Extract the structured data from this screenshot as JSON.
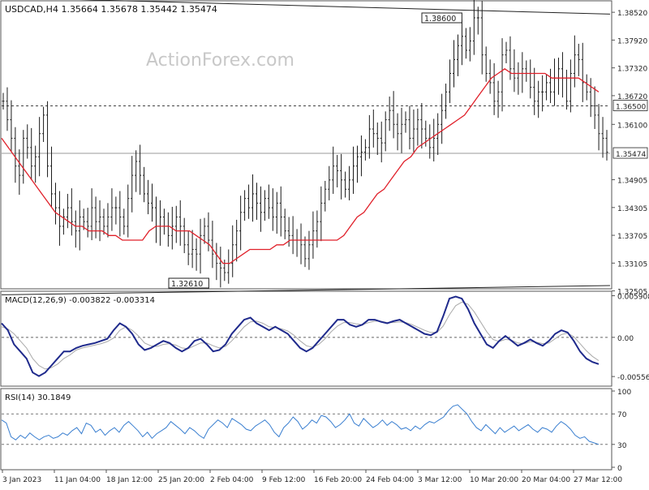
{
  "header": {
    "symbol_line": "USDCAD,H4  1.35664 1.35678 1.35442 1.35474"
  },
  "watermark": "ActionForex.com",
  "colors": {
    "candle": "#1a1a1a",
    "ma": "#e0202a",
    "macd_line": "#1f2a8c",
    "macd_signal": "#aaaaaa",
    "rsi": "#3a7fd0",
    "grid_dash": "#444444",
    "axis_text": "#222222"
  },
  "chart_data": [
    {
      "type": "line",
      "name": "price",
      "title": "USDCAD,H4  1.35664 1.35678 1.35442 1.35474",
      "ylim": [
        1.3255,
        1.3875
      ],
      "yticks": [
        "1.38520",
        "1.37920",
        "1.37320",
        "1.36720",
        "1.36100",
        "1.35474",
        "1.34905",
        "1.34305",
        "1.33705",
        "1.33105",
        "1.32505"
      ],
      "ytick_values": [
        1.3852,
        1.3792,
        1.3732,
        1.3672,
        1.361,
        1.35474,
        1.34905,
        1.34305,
        1.33705,
        1.33105,
        1.32505
      ],
      "xlabels": [
        "3 Jan 2023",
        "11 Jan 04:00",
        "18 Jan 12:00",
        "25 Jan 20:00",
        "2 Feb 04:00",
        "9 Feb 12:00",
        "16 Feb 20:00",
        "24 Feb 04:00",
        "3 Mar 12:00",
        "10 Mar 20:00",
        "20 Mar 04:00",
        "27 Mar 12:00"
      ],
      "annotations": {
        "high_label": "1.38600",
        "low_label": "1.32610",
        "level_label": "1.36500",
        "last_price": "1.35474",
        "high_value": 1.386,
        "low_value": 1.3261,
        "level_value": 1.365
      },
      "series": [
        {
          "values": [
            1.366,
            1.362,
            1.358,
            1.352,
            1.35,
            1.358,
            1.356,
            1.352,
            1.354,
            1.359,
            1.363,
            1.352,
            1.346,
            1.343,
            1.339,
            1.341,
            1.343,
            1.34,
            1.338,
            1.341,
            1.34,
            1.339,
            1.343,
            1.34,
            1.341,
            1.339,
            1.341,
            1.343,
            1.343,
            1.341,
            1.339,
            1.345,
            1.35,
            1.353,
            1.35,
            1.346,
            1.344,
            1.343,
            1.339,
            1.341,
            1.339,
            1.337,
            1.339,
            1.341,
            1.339,
            1.335,
            1.333,
            1.334,
            1.333,
            1.337,
            1.339,
            1.336,
            1.333,
            1.331,
            1.33,
            1.329,
            1.331,
            1.335,
            1.338,
            1.342,
            1.345,
            1.343,
            1.346,
            1.344,
            1.342,
            1.345,
            1.343,
            1.341,
            1.344,
            1.341,
            1.338,
            1.337,
            1.336,
            1.336,
            1.335,
            1.332,
            1.335,
            1.338,
            1.34,
            1.344,
            1.347,
            1.349,
            1.352,
            1.351,
            1.349,
            1.347,
            1.349,
            1.352,
            1.354,
            1.355,
            1.356,
            1.36,
            1.359,
            1.358,
            1.357,
            1.362,
            1.364,
            1.361,
            1.359,
            1.361,
            1.362,
            1.358,
            1.36,
            1.362,
            1.36,
            1.358,
            1.356,
            1.358,
            1.361,
            1.364,
            1.368,
            1.372,
            1.375,
            1.378,
            1.38,
            1.377,
            1.379,
            1.384,
            1.384,
            1.376,
            1.372,
            1.37,
            1.366,
            1.368,
            1.376,
            1.377,
            1.373,
            1.371,
            1.372,
            1.373,
            1.372,
            1.369,
            1.366,
            1.368,
            1.368,
            1.37,
            1.368,
            1.371,
            1.373,
            1.371,
            1.366,
            1.372,
            1.376,
            1.375,
            1.37,
            1.368,
            1.365,
            1.363,
            1.359,
            1.358,
            1.355
          ]
        },
        {
          "values": [
            1.358,
            1.356,
            1.354,
            1.352,
            1.35,
            1.348,
            1.346,
            1.344,
            1.342,
            1.341,
            1.34,
            1.339,
            1.339,
            1.338,
            1.338,
            1.338,
            1.337,
            1.337,
            1.336,
            1.336,
            1.336,
            1.336,
            1.338,
            1.339,
            1.339,
            1.339,
            1.338,
            1.338,
            1.338,
            1.337,
            1.336,
            1.335,
            1.333,
            1.331,
            1.331,
            1.332,
            1.333,
            1.334,
            1.334,
            1.334,
            1.334,
            1.335,
            1.335,
            1.336,
            1.336,
            1.336,
            1.336,
            1.336,
            1.336,
            1.336,
            1.336,
            1.337,
            1.339,
            1.341,
            1.342,
            1.344,
            1.346,
            1.347,
            1.349,
            1.351,
            1.353,
            1.354,
            1.356,
            1.357,
            1.358,
            1.359,
            1.36,
            1.361,
            1.362,
            1.363,
            1.365,
            1.367,
            1.369,
            1.371,
            1.372,
            1.373,
            1.372,
            1.372,
            1.372,
            1.372,
            1.372,
            1.372,
            1.371,
            1.371,
            1.371,
            1.371,
            1.371,
            1.37,
            1.369,
            1.368
          ]
        }
      ]
    },
    {
      "type": "line",
      "name": "macd",
      "title": "MACD(12,26,9) -0.003822 -0.003314",
      "ylim": [
        -0.0067,
        0.0062
      ],
      "yticks": [
        "0.005908",
        "0.00",
        "-0.005563"
      ],
      "ytick_values": [
        0.005908,
        0.0,
        -0.005563
      ],
      "series": [
        {
          "values": [
            0.002,
            0.001,
            -0.001,
            -0.002,
            -0.003,
            -0.005,
            -0.0055,
            -0.005,
            -0.004,
            -0.003,
            -0.002,
            -0.002,
            -0.0015,
            -0.0012,
            -0.001,
            -0.0008,
            -0.0005,
            -0.0002,
            0.001,
            0.002,
            0.0015,
            0.0005,
            -0.001,
            -0.0018,
            -0.0015,
            -0.001,
            -0.0005,
            -0.0008,
            -0.0015,
            -0.002,
            -0.0015,
            -0.0005,
            -0.0002,
            -0.001,
            -0.002,
            -0.0018,
            -0.001,
            0.0005,
            0.0015,
            0.0025,
            0.0028,
            0.002,
            0.0015,
            0.001,
            0.0015,
            0.001,
            0.0005,
            -0.0005,
            -0.0015,
            -0.002,
            -0.0015,
            -0.0005,
            0.0005,
            0.0015,
            0.0025,
            0.0025,
            0.0018,
            0.0015,
            0.0018,
            0.0025,
            0.0025,
            0.0022,
            0.002,
            0.0023,
            0.0025,
            0.002,
            0.0015,
            0.001,
            0.0005,
            0.0003,
            0.0008,
            0.003,
            0.0055,
            0.0058,
            0.0055,
            0.004,
            0.002,
            0.0005,
            -0.001,
            -0.0015,
            -0.0005,
            0.0002,
            -0.0005,
            -0.0012,
            -0.0008,
            -0.0003,
            -0.0008,
            -0.0012,
            -0.0005,
            0.0005,
            0.001,
            0.0007,
            -0.0005,
            -0.002,
            -0.003,
            -0.0035,
            -0.0038
          ]
        },
        {
          "values": [
            0.0015,
            0.0012,
            0.0005,
            -0.0005,
            -0.0015,
            -0.003,
            -0.004,
            -0.0045,
            -0.0043,
            -0.0038,
            -0.003,
            -0.0025,
            -0.0018,
            -0.0015,
            -0.0013,
            -0.0011,
            -0.0009,
            -0.0006,
            -0.0001,
            0.001,
            0.0015,
            0.001,
            0.0002,
            -0.0008,
            -0.0012,
            -0.0013,
            -0.001,
            -0.0009,
            -0.0011,
            -0.0015,
            -0.0016,
            -0.0012,
            -0.0008,
            -0.0008,
            -0.0012,
            -0.0015,
            -0.0013,
            -0.0005,
            0.0005,
            0.0015,
            0.0022,
            0.0023,
            0.002,
            0.0015,
            0.0014,
            0.0012,
            0.0009,
            0.0003,
            -0.0005,
            -0.0012,
            -0.0014,
            -0.001,
            -0.0002,
            0.0008,
            0.0016,
            0.0021,
            0.0021,
            0.0019,
            0.0018,
            0.0021,
            0.0023,
            0.0023,
            0.0021,
            0.0021,
            0.0022,
            0.0021,
            0.0018,
            0.0014,
            0.001,
            0.0007,
            0.0007,
            0.0016,
            0.0032,
            0.0045,
            0.005,
            0.0047,
            0.0036,
            0.0022,
            0.0008,
            -0.0003,
            -0.0006,
            -0.0003,
            -0.0004,
            -0.0008,
            -0.0009,
            -0.0006,
            -0.0007,
            -0.0009,
            -0.0008,
            -0.0002,
            0.0004,
            0.0006,
            0.0001,
            -0.0009,
            -0.0019,
            -0.0027,
            -0.0033
          ]
        }
      ]
    },
    {
      "type": "line",
      "name": "rsi",
      "title": "RSI(14) 30.1849",
      "ylim": [
        0,
        100
      ],
      "yticks": [
        "100",
        "70",
        "30",
        "0"
      ],
      "ytick_values": [
        100,
        70,
        30,
        0
      ],
      "series": [
        {
          "values": [
            62,
            58,
            40,
            36,
            42,
            38,
            45,
            40,
            36,
            40,
            42,
            38,
            40,
            45,
            42,
            48,
            52,
            44,
            58,
            55,
            46,
            50,
            42,
            48,
            52,
            46,
            55,
            60,
            54,
            48,
            40,
            46,
            38,
            44,
            48,
            52,
            60,
            55,
            50,
            44,
            52,
            48,
            42,
            38,
            50,
            56,
            62,
            58,
            52,
            64,
            60,
            56,
            50,
            48,
            54,
            58,
            62,
            56,
            46,
            40,
            52,
            58,
            66,
            60,
            50,
            55,
            62,
            58,
            68,
            66,
            60,
            52,
            56,
            62,
            70,
            58,
            54,
            64,
            58,
            52,
            56,
            62,
            55,
            60,
            56,
            50,
            52,
            48,
            54,
            50,
            56,
            60,
            58,
            62,
            66,
            74,
            80,
            82,
            76,
            70,
            60,
            52,
            48,
            56,
            50,
            44,
            52,
            46,
            50,
            54,
            48,
            52,
            56,
            50,
            46,
            52,
            50,
            46,
            54,
            60,
            56,
            50,
            42,
            38,
            40,
            34,
            32,
            30
          ]
        }
      ]
    }
  ]
}
